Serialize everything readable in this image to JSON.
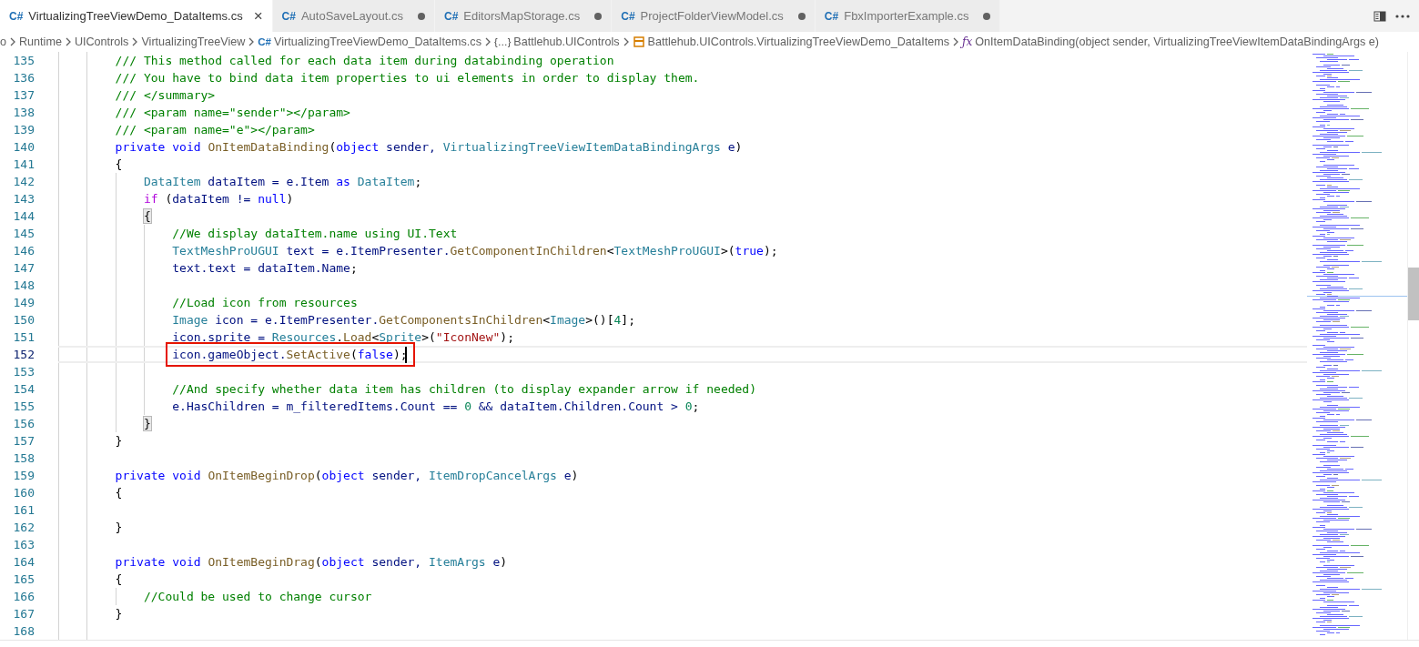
{
  "tabs": [
    {
      "lang": "C#",
      "label": "VirtualizingTreeViewDemo_DataItems.cs",
      "selected": true,
      "modified": false,
      "close": "×"
    },
    {
      "lang": "C#",
      "label": "AutoSaveLayout.cs",
      "selected": false,
      "modified": true
    },
    {
      "lang": "C#",
      "label": "EditorsMapStorage.cs",
      "selected": false,
      "modified": true
    },
    {
      "lang": "C#",
      "label": "ProjectFolderViewModel.cs",
      "selected": false,
      "modified": true
    },
    {
      "lang": "C#",
      "label": "FbxImporterExample.cs",
      "selected": false,
      "modified": true
    }
  ],
  "breadcrumb": [
    {
      "kind": "folder",
      "label": "o"
    },
    {
      "kind": "folder",
      "label": "Runtime"
    },
    {
      "kind": "folder",
      "label": "UIControls"
    },
    {
      "kind": "folder",
      "label": "VirtualizingTreeView"
    },
    {
      "kind": "file",
      "glyph": "C#",
      "label": "VirtualizingTreeViewDemo_DataItems.cs"
    },
    {
      "kind": "namespace",
      "glyph": "{…}",
      "label": "Battlehub.UIControls"
    },
    {
      "kind": "class",
      "label": "Battlehub.UIControls.VirtualizingTreeViewDemo_DataItems"
    },
    {
      "kind": "method",
      "glyph": "ƒx",
      "label": "OnItemDataBinding(object sender, VirtualizingTreeViewItemDataBindingArgs e)"
    }
  ],
  "lines": [
    {
      "number": "135",
      "tokens": [
        {
          "kind": "comment",
          "text": "        /// This method called for each data item during databinding operation"
        }
      ]
    },
    {
      "number": "136",
      "tokens": [
        {
          "kind": "comment",
          "text": "        /// You have to bind data item properties to ui elements in order to display them."
        }
      ]
    },
    {
      "number": "137",
      "tokens": [
        {
          "kind": "comment",
          "text": "        /// </summary>"
        }
      ]
    },
    {
      "number": "138",
      "tokens": [
        {
          "kind": "comment",
          "text": "        /// <param name=\"sender\"></param>"
        }
      ]
    },
    {
      "number": "139",
      "tokens": [
        {
          "kind": "comment",
          "text": "        /// <param name=\"e\"></param>"
        }
      ]
    },
    {
      "number": "140",
      "tokens": [
        {
          "kind": "keyword",
          "text": "        private void "
        },
        {
          "kind": "method",
          "text": "OnItemDataBinding"
        },
        {
          "kind": "plain",
          "text": "("
        },
        {
          "kind": "keyword",
          "text": "object"
        },
        {
          "kind": "variable",
          "text": " sender, "
        },
        {
          "kind": "type",
          "text": "VirtualizingTreeViewItemDataBindingArgs"
        },
        {
          "kind": "variable",
          "text": " e"
        },
        {
          "kind": "plain",
          "text": ")"
        }
      ]
    },
    {
      "number": "141",
      "tokens": [
        {
          "kind": "plain",
          "text": "        {"
        }
      ]
    },
    {
      "number": "142",
      "tokens": [
        {
          "kind": "type",
          "text": "            DataItem"
        },
        {
          "kind": "variable",
          "text": " dataItem = e.Item "
        },
        {
          "kind": "keyword",
          "text": "as"
        },
        {
          "kind": "type",
          "text": " DataItem"
        },
        {
          "kind": "plain",
          "text": ";"
        }
      ]
    },
    {
      "number": "143",
      "tokens": [
        {
          "kind": "control",
          "text": "            if"
        },
        {
          "kind": "plain",
          "text": " ("
        },
        {
          "kind": "variable",
          "text": "dataItem != "
        },
        {
          "kind": "keyword",
          "text": "null"
        },
        {
          "kind": "plain",
          "text": ")"
        }
      ]
    },
    {
      "number": "144",
      "tokens": [
        {
          "kind": "brace",
          "text": "            {",
          "matched": true
        }
      ]
    },
    {
      "number": "145",
      "tokens": [
        {
          "kind": "comment",
          "text": "                //We display dataItem.name using UI.Text"
        }
      ]
    },
    {
      "number": "146",
      "tokens": [
        {
          "kind": "type",
          "text": "                TextMeshProUGUI"
        },
        {
          "kind": "variable",
          "text": " text = e.ItemPresenter."
        },
        {
          "kind": "method",
          "text": "GetComponentInChildren"
        },
        {
          "kind": "plain",
          "text": "<"
        },
        {
          "kind": "type",
          "text": "TextMeshProUGUI"
        },
        {
          "kind": "plain",
          "text": ">("
        },
        {
          "kind": "keyword",
          "text": "true"
        },
        {
          "kind": "plain",
          "text": ");"
        }
      ]
    },
    {
      "number": "147",
      "tokens": [
        {
          "kind": "variable",
          "text": "                text.text = dataItem.Name"
        },
        {
          "kind": "plain",
          "text": ";"
        }
      ]
    },
    {
      "number": "148"
    },
    {
      "number": "149",
      "tokens": [
        {
          "kind": "comment",
          "text": "                //Load icon from resources"
        }
      ]
    },
    {
      "number": "150",
      "tokens": [
        {
          "kind": "type",
          "text": "                Image"
        },
        {
          "kind": "variable",
          "text": " icon = e.ItemPresenter."
        },
        {
          "kind": "method",
          "text": "GetComponentsInChildren"
        },
        {
          "kind": "plain",
          "text": "<"
        },
        {
          "kind": "type",
          "text": "Image"
        },
        {
          "kind": "plain",
          "text": ">()["
        },
        {
          "kind": "number",
          "text": "4"
        },
        {
          "kind": "plain",
          "text": "];"
        }
      ]
    },
    {
      "number": "151",
      "tokens": [
        {
          "kind": "variable",
          "text": "                icon.sprite = "
        },
        {
          "kind": "type",
          "text": "Resources"
        },
        {
          "kind": "plain",
          "text": "."
        },
        {
          "kind": "method",
          "text": "Load"
        },
        {
          "kind": "plain",
          "text": "<"
        },
        {
          "kind": "type",
          "text": "Sprite"
        },
        {
          "kind": "plain",
          "text": ">("
        },
        {
          "kind": "string",
          "text": "\"IconNew\""
        },
        {
          "kind": "plain",
          "text": ");"
        }
      ]
    },
    {
      "number": "152",
      "current": true,
      "boxed": true,
      "cursor": true,
      "tokens": [
        {
          "kind": "variable",
          "text": "                icon.gameObject."
        },
        {
          "kind": "method",
          "text": "SetActive"
        },
        {
          "kind": "plain",
          "text": "("
        },
        {
          "kind": "keyword",
          "text": "false"
        },
        {
          "kind": "plain",
          "text": ");"
        }
      ]
    },
    {
      "number": "153"
    },
    {
      "number": "154",
      "tokens": [
        {
          "kind": "comment",
          "text": "                //And specify whether data item has children (to display expander arrow if needed)"
        }
      ]
    },
    {
      "number": "155",
      "tokens": [
        {
          "kind": "variable",
          "text": "                e.HasChildren = m_filteredItems.Count == "
        },
        {
          "kind": "number",
          "text": "0"
        },
        {
          "kind": "variable",
          "text": " && dataItem.Children.Count > "
        },
        {
          "kind": "number",
          "text": "0"
        },
        {
          "kind": "plain",
          "text": ";"
        }
      ]
    },
    {
      "number": "156",
      "tokens": [
        {
          "kind": "brace",
          "text": "            }",
          "matched": true
        }
      ]
    },
    {
      "number": "157",
      "tokens": [
        {
          "kind": "plain",
          "text": "        }"
        }
      ]
    },
    {
      "number": "158"
    },
    {
      "number": "159",
      "tokens": [
        {
          "kind": "keyword",
          "text": "        private void "
        },
        {
          "kind": "method",
          "text": "OnItemBeginDrop"
        },
        {
          "kind": "plain",
          "text": "("
        },
        {
          "kind": "keyword",
          "text": "object"
        },
        {
          "kind": "variable",
          "text": " sender, "
        },
        {
          "kind": "type",
          "text": "ItemDropCancelArgs"
        },
        {
          "kind": "variable",
          "text": " e"
        },
        {
          "kind": "plain",
          "text": ")"
        }
      ]
    },
    {
      "number": "160",
      "tokens": [
        {
          "kind": "plain",
          "text": "        {"
        }
      ]
    },
    {
      "number": "161"
    },
    {
      "number": "162",
      "tokens": [
        {
          "kind": "plain",
          "text": "        }"
        }
      ]
    },
    {
      "number": "163"
    },
    {
      "number": "164",
      "tokens": [
        {
          "kind": "keyword",
          "text": "        private void "
        },
        {
          "kind": "method",
          "text": "OnItemBeginDrag"
        },
        {
          "kind": "plain",
          "text": "("
        },
        {
          "kind": "keyword",
          "text": "object"
        },
        {
          "kind": "variable",
          "text": " sender, "
        },
        {
          "kind": "type",
          "text": "ItemArgs"
        },
        {
          "kind": "variable",
          "text": " e"
        },
        {
          "kind": "plain",
          "text": ")"
        }
      ]
    },
    {
      "number": "165",
      "tokens": [
        {
          "kind": "plain",
          "text": "        {"
        }
      ]
    },
    {
      "number": "166",
      "tokens": [
        {
          "kind": "comment",
          "text": "            //Could be used to change cursor"
        }
      ]
    },
    {
      "number": "167",
      "tokens": [
        {
          "kind": "plain",
          "text": "        }"
        }
      ]
    },
    {
      "number": "168"
    }
  ]
}
